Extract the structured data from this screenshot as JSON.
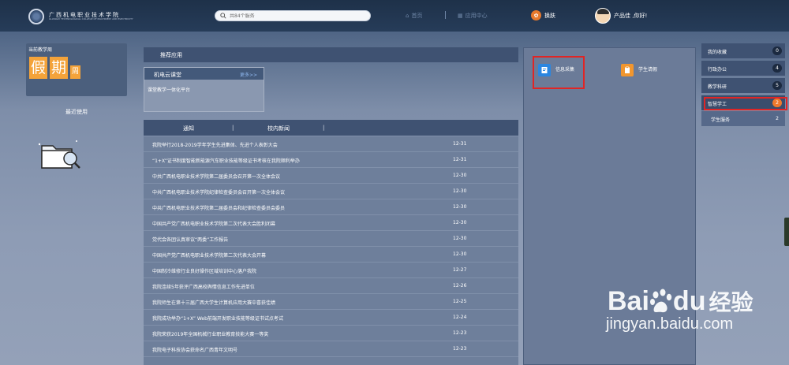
{
  "header": {
    "school_name": "广西机电职业技术学院",
    "school_sub": "GUANGXI TECHNOLOGICAL COLLEGE OF MACHINERY AND ELECTRICITY",
    "search_placeholder": "共84个服务",
    "nav_home": "首页",
    "nav_apps": "应用中心",
    "skin_label": "换肤",
    "user_greeting": "产品佳 ,你好!"
  },
  "left": {
    "term_label": "当前教学周",
    "term_char1": "假",
    "term_char2": "期",
    "term_char3": "周",
    "recent_title": "最近使用"
  },
  "recommended": {
    "title": "推荐应用",
    "cloud_title": "机电云课堂",
    "cloud_more": "更多>>",
    "cloud_item": "课堂教学一体化平台"
  },
  "news": {
    "tabs": [
      "通知",
      "校内新闻"
    ],
    "items": [
      {
        "title": "我院举行2018-2019学年学生先进集体、先进个人表彰大会",
        "date": "12-31"
      },
      {
        "title": "“1+X”证书制度智能新能源汽车职业技能等级证书考核在我院顺利举办",
        "date": "12-31"
      },
      {
        "title": "中共广西机电职业技术学院第二届委员会召开第一次全体会议",
        "date": "12-30"
      },
      {
        "title": "中共广西机电职业技术学院纪律检查委员会召开第一次全体会议",
        "date": "12-30"
      },
      {
        "title": "中共广西机电职业技术学院第二届委员会和纪律检查委员会委员",
        "date": "12-30"
      },
      {
        "title": "中国共产党广西机电职业技术学院第二次代表大会胜利闭幕",
        "date": "12-30"
      },
      {
        "title": "党代会各团认真审议“两委”工作报告",
        "date": "12-30"
      },
      {
        "title": "中国共产党广西机电职业技术学院第二次代表大会开幕",
        "date": "12-30"
      },
      {
        "title": "中国制冷维修行业良好操作区域培训中心落户我院",
        "date": "12-27"
      },
      {
        "title": "我院连续5年获评广西高校舆情信息工作先进单位",
        "date": "12-26"
      },
      {
        "title": "我院师生在第十三届广西大学生计算机应用大赛中喜获佳绩",
        "date": "12-25"
      },
      {
        "title": "我院成功举办“1+X” Web前端开发职业技能等级证书试点考试",
        "date": "12-24"
      },
      {
        "title": "我院荣获2019年全国机械行业职业教育技能大赛一等奖",
        "date": "12-23"
      },
      {
        "title": "我院电子科技协会获命名广西青年文明号",
        "date": "12-23"
      }
    ]
  },
  "apps": {
    "items": [
      {
        "label": "信息采集",
        "icon": "form-icon",
        "color": "#2b86e0"
      },
      {
        "label": "学生请假",
        "icon": "clipboard-icon",
        "color": "#f2962e"
      }
    ]
  },
  "menu": {
    "items": [
      {
        "label": "我的收藏",
        "count": "0"
      },
      {
        "label": "行政办公",
        "count": "4"
      },
      {
        "label": "教学科研",
        "count": "5"
      },
      {
        "label": "智慧学工",
        "count": "2"
      },
      {
        "label": "学生服务",
        "count": "2"
      }
    ]
  },
  "watermark": {
    "brand_bai": "Bai",
    "brand_du": "du",
    "brand_cn": "经验",
    "url": "jingyan.baidu.com"
  },
  "colors": {
    "accent_orange": "#f0792c",
    "highlight_red": "#e02525"
  }
}
